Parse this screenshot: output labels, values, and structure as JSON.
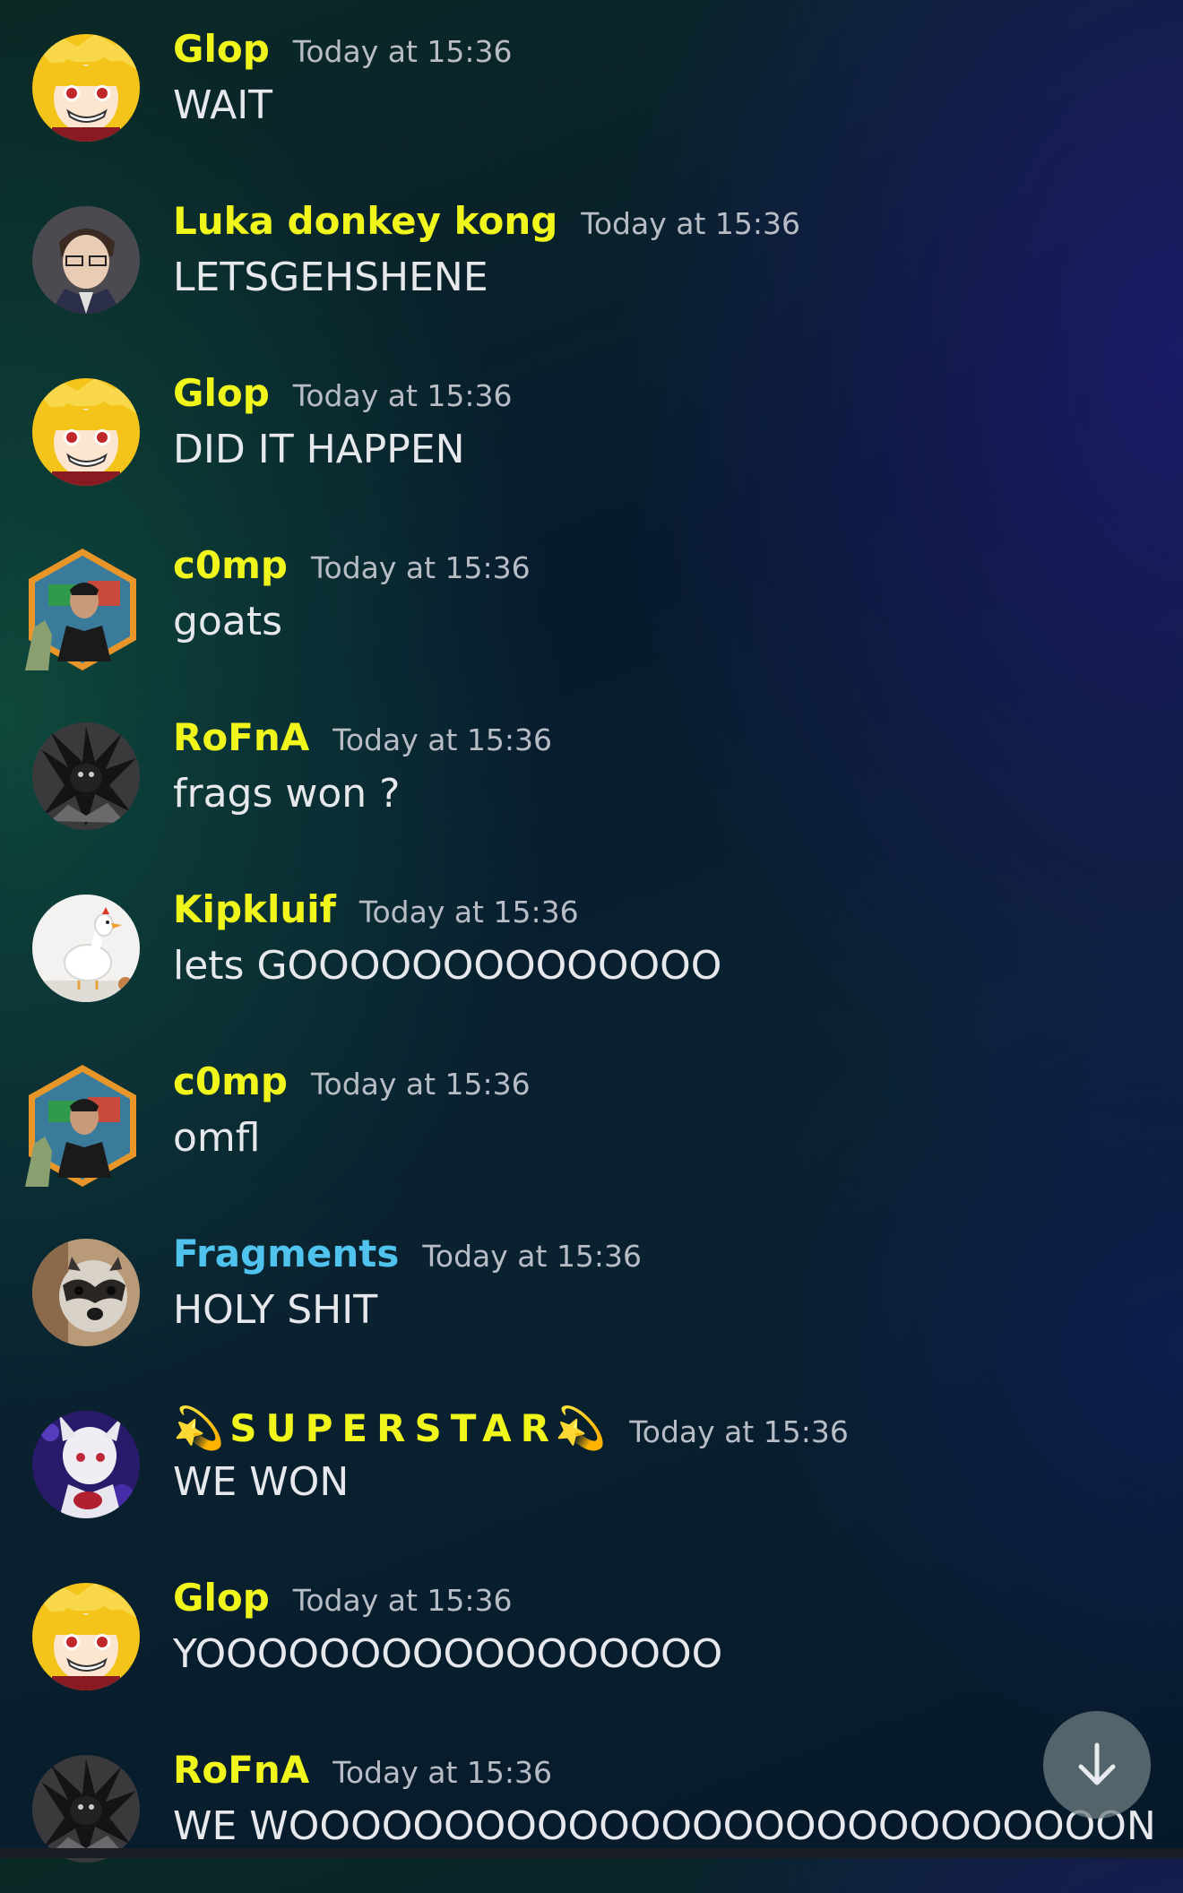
{
  "messages": [
    {
      "username": "Glop",
      "timestamp": "Today at 15:36",
      "content": "WAIT",
      "avatar": "blonde-anime-avatar"
    },
    {
      "username": "Luka donkey kong",
      "timestamp": "Today at 15:36",
      "content": "LETSGEHSHENE",
      "avatar": "anime-man-glasses-avatar"
    },
    {
      "username": "Glop",
      "timestamp": "Today at 15:36",
      "content": "DID IT HAPPEN",
      "avatar": "blonde-anime-avatar"
    },
    {
      "username": "c0mp",
      "timestamp": "Today at 15:36",
      "content": "goats",
      "avatar": "hexagon-photo-avatar"
    },
    {
      "username": "RoFnA",
      "timestamp": "Today at 15:36",
      "content": "frags won ?",
      "avatar": "dark-creature-avatar"
    },
    {
      "username": "Kipkluif",
      "timestamp": "Today at 15:36",
      "content": "lets GOOOOOOOOOOOOOO",
      "avatar": "white-chicken-avatar"
    },
    {
      "username": "c0mp",
      "timestamp": "Today at 15:36",
      "content": "omfl",
      "avatar": "hexagon-photo-avatar"
    },
    {
      "username": "Fragments",
      "timestamp": "Today at 15:36",
      "content": "HOLY SHIT",
      "avatar": "raccoon-avatar"
    },
    {
      "username": "SUPERSTAR",
      "username_decoration": "💫",
      "timestamp": "Today at 15:36",
      "content": "WE WON",
      "avatar": "anime-girl-avatar"
    },
    {
      "username": "Glop",
      "timestamp": "Today at 15:36",
      "content": "YOOOOOOOOOOOOOOOOO",
      "avatar": "blonde-anime-avatar"
    },
    {
      "username": "RoFnA",
      "timestamp": "Today at 15:36",
      "content": "WE WOOOOOOOOOOOOOOOOOOOOOOOOOOON",
      "avatar": "dark-creature-avatar"
    }
  ],
  "scroll_button": {
    "icon": "arrow-down-icon"
  },
  "colors": {
    "username_default": "#f0f51c",
    "username_fragments": "#4fc3ee",
    "timestamp": "#b8bcc4",
    "content": "#e6e8ec"
  }
}
